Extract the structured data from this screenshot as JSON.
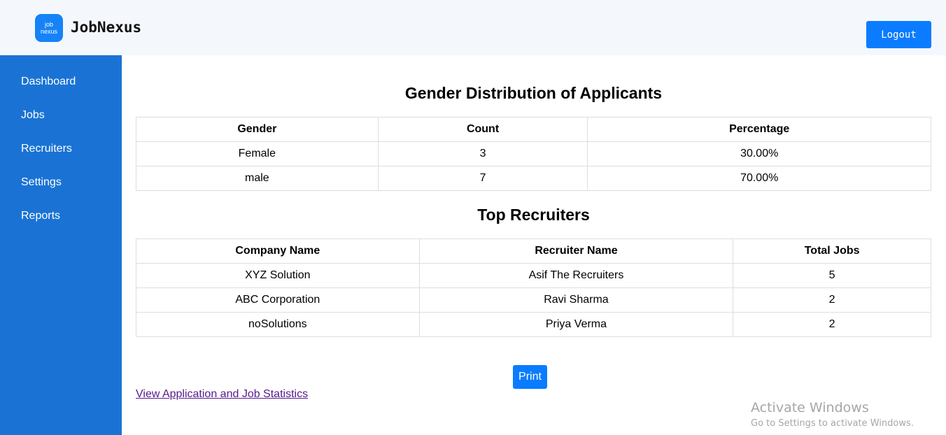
{
  "header": {
    "logo_line1": "job",
    "logo_line2": "nexus",
    "brand": "JobNexus",
    "logout_label": "Logout"
  },
  "sidebar": {
    "items": [
      {
        "label": "Dashboard"
      },
      {
        "label": "Jobs"
      },
      {
        "label": "Recruiters"
      },
      {
        "label": "Settings"
      },
      {
        "label": "Reports"
      }
    ]
  },
  "gender_section": {
    "title": "Gender Distribution of Applicants",
    "headers": [
      "Gender",
      "Count",
      "Percentage"
    ],
    "rows": [
      [
        "Female",
        "3",
        "30.00%"
      ],
      [
        "male",
        "7",
        "70.00%"
      ]
    ]
  },
  "recruiters_section": {
    "title": "Top Recruiters",
    "headers": [
      "Company Name",
      "Recruiter Name",
      "Total Jobs"
    ],
    "rows": [
      [
        "XYZ Solution",
        "Asif The Recruiters",
        "5"
      ],
      [
        "ABC Corporation",
        "Ravi Sharma",
        "2"
      ],
      [
        "noSolutions",
        "Priya Verma",
        "2"
      ]
    ]
  },
  "actions": {
    "print_label": "Print",
    "stats_link": "View Application and Job Statistics"
  },
  "watermark": {
    "title": "Activate Windows",
    "subtitle": "Go to Settings to activate Windows."
  },
  "colors": {
    "primary": "#0b7cff",
    "sidebar": "#1a73d4",
    "header_bg": "#f4f8fd"
  }
}
